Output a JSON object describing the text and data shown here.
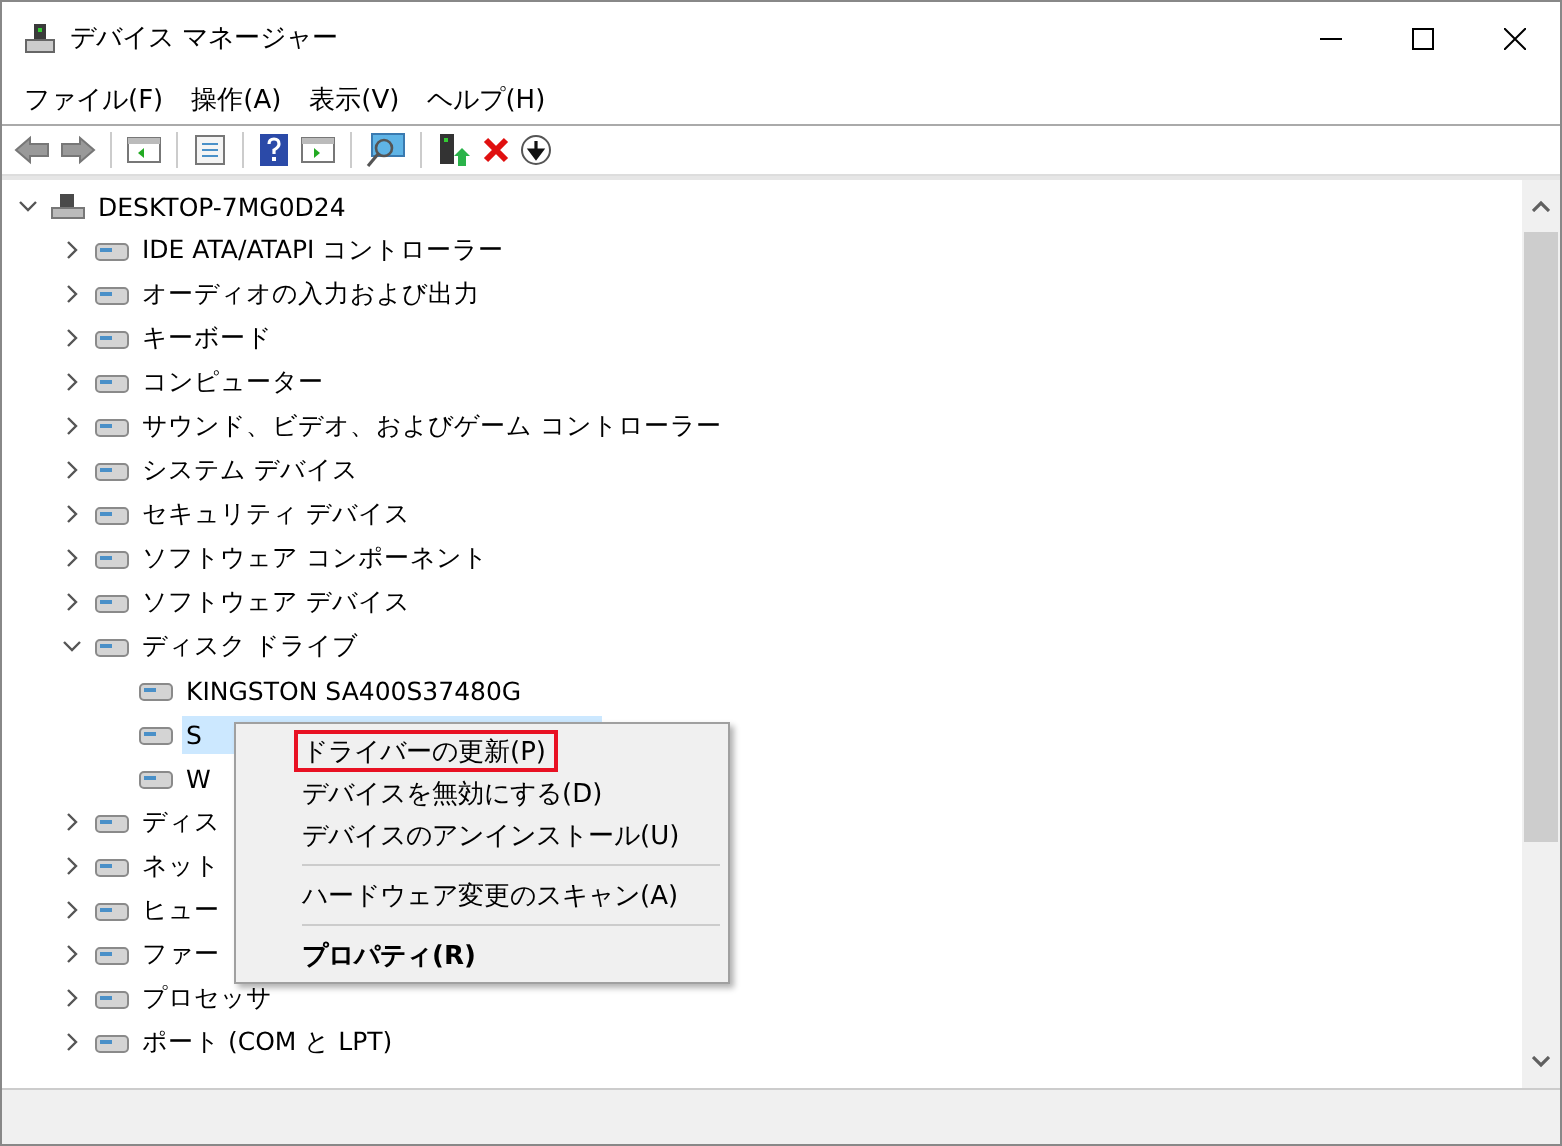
{
  "window": {
    "title": "デバイス マネージャー"
  },
  "menu": [
    "ファイル(F)",
    "操作(A)",
    "表示(V)",
    "ヘルプ(H)"
  ],
  "tree": {
    "label": "DESKTOP-7MG0D24",
    "expanded": true,
    "selected": false,
    "children": [
      {
        "label": "IDE ATA/ATAPI コントローラー",
        "expanded": false,
        "selected": false
      },
      {
        "label": "オーディオの入力および出力",
        "expanded": false,
        "selected": false
      },
      {
        "label": "キーボード",
        "expanded": false,
        "selected": false
      },
      {
        "label": "コンピューター",
        "expanded": false,
        "selected": false
      },
      {
        "label": "サウンド、ビデオ、およびゲーム コントローラー",
        "expanded": false,
        "selected": false
      },
      {
        "label": "システム デバイス",
        "expanded": false,
        "selected": false
      },
      {
        "label": "セキュリティ デバイス",
        "expanded": false,
        "selected": false
      },
      {
        "label": "ソフトウェア コンポーネント",
        "expanded": false,
        "selected": false
      },
      {
        "label": "ソフトウェア デバイス",
        "expanded": false,
        "selected": false
      },
      {
        "label": "ディスク ドライブ",
        "expanded": true,
        "selected": false,
        "children": [
          {
            "label": "KINGSTON SA400S37480G",
            "selected": false
          },
          {
            "label": "S",
            "selected": true
          },
          {
            "label": "W",
            "selected": false
          }
        ]
      },
      {
        "label": "ディス",
        "expanded": false,
        "selected": false
      },
      {
        "label": "ネット",
        "expanded": false,
        "selected": false
      },
      {
        "label": "ヒュー",
        "expanded": false,
        "selected": false
      },
      {
        "label": "ファー",
        "expanded": false,
        "selected": false
      },
      {
        "label": "プロセッサ",
        "expanded": false,
        "selected": false
      },
      {
        "label": "ポート (COM と LPT)",
        "expanded": false,
        "selected": false
      }
    ]
  },
  "context_menu": [
    {
      "kind": "command",
      "label": "ドライバーの更新(P)",
      "focused": true,
      "default": false
    },
    {
      "kind": "command",
      "label": "デバイスを無効にする(D)",
      "focused": false,
      "default": false
    },
    {
      "kind": "command",
      "label": "デバイスのアンインストール(U)",
      "focused": false,
      "default": false
    },
    {
      "kind": "separator"
    },
    {
      "kind": "command",
      "label": "ハードウェア変更のスキャン(A)",
      "focused": false,
      "default": false
    },
    {
      "kind": "separator"
    },
    {
      "kind": "command",
      "label": "プロパティ(R)",
      "focused": false,
      "default": true
    }
  ]
}
